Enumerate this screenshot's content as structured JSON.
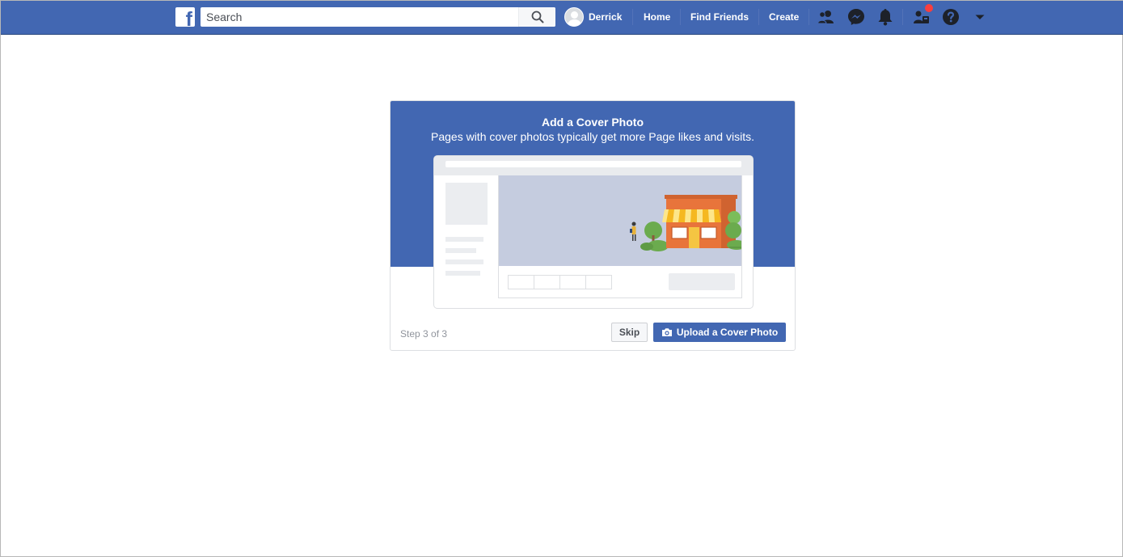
{
  "topbar": {
    "logo_letter": "f",
    "search": {
      "placeholder": "Search",
      "value": ""
    },
    "profile_name": "Derrick",
    "nav_links": [
      "Home",
      "Find Friends",
      "Create"
    ],
    "icons": [
      "friend-requests-icon",
      "messenger-icon",
      "notifications-bell-icon",
      "quick-help-people-icon",
      "help-question-icon",
      "account-menu-caret-icon"
    ],
    "notification_badge_color": "#fa3e3e"
  },
  "dialog": {
    "title": "Add a Cover Photo",
    "subtitle": "Pages with cover photos typically get more Page likes and visits.",
    "step_text": "Step 3 of 3",
    "skip_label": "Skip",
    "upload_label": "Upload a Cover Photo"
  },
  "colors": {
    "brand_blue": "#4267b2",
    "cover_placeholder": "#c5ccdf",
    "shop_orange": "#e8743b",
    "tree_green": "#6bab4e"
  }
}
